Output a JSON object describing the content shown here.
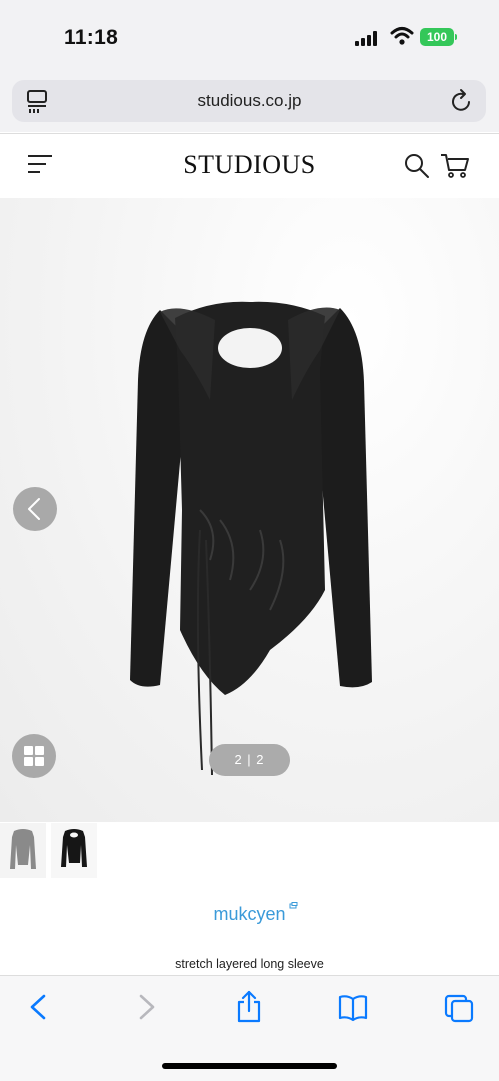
{
  "status_bar": {
    "time": "11:18",
    "battery": "100",
    "icons": [
      "cellular-signal-icon",
      "wifi-icon",
      "battery-icon"
    ]
  },
  "browser": {
    "url": "studious.co.jp",
    "icons": [
      "reader-mode-icon",
      "reload-icon"
    ]
  },
  "site_header": {
    "logo": "STUDIOUS",
    "icons": [
      "hamburger-menu-icon",
      "search-icon",
      "cart-icon"
    ]
  },
  "gallery": {
    "pager": "2 | 2",
    "thumbnails": [
      "thumbnail-1",
      "thumbnail-2"
    ],
    "icons": [
      "chevron-left-icon",
      "grid-icon"
    ]
  },
  "product": {
    "brand": "mukcyen",
    "name": "stretch layered long sleeve"
  },
  "toolbar": {
    "icons": [
      "back-icon",
      "forward-icon",
      "share-icon",
      "bookmarks-icon",
      "tabs-icon"
    ]
  },
  "colors": {
    "brand_link": "#3a9ad9",
    "battery": "#34c759",
    "ios_blue": "#0a7aff",
    "garment": "#1c1c1c"
  }
}
